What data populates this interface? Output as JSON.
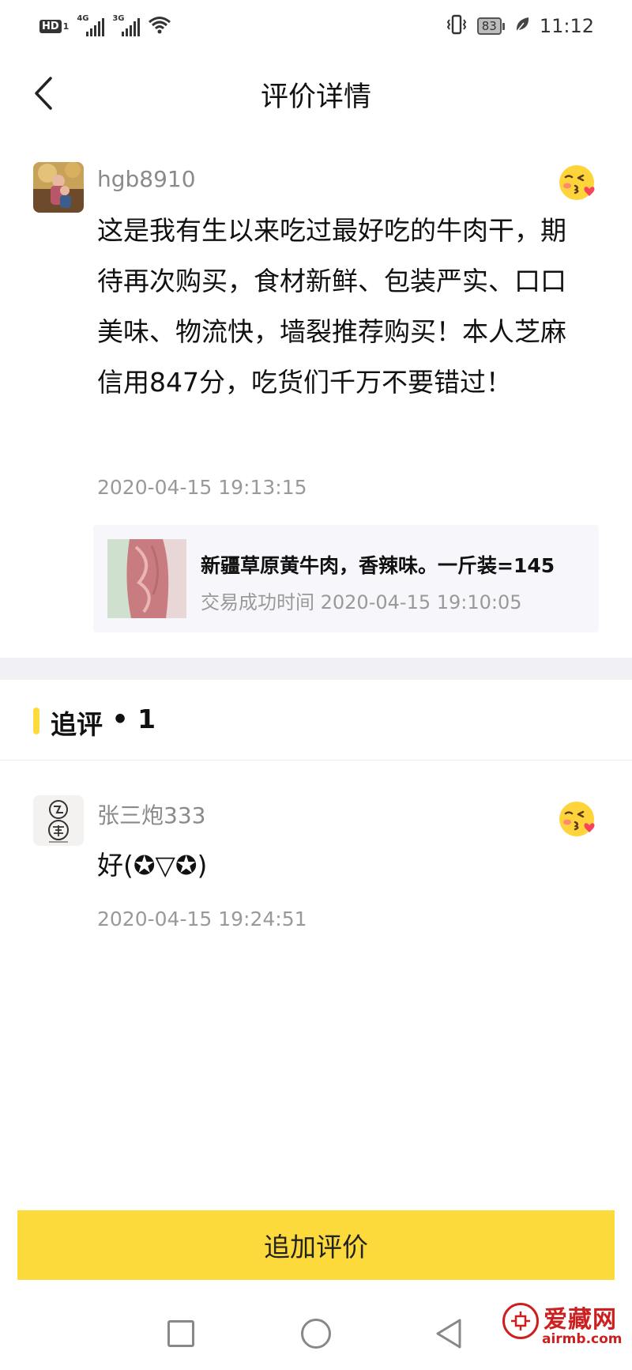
{
  "status_bar": {
    "hd_label": "HD",
    "hd_sub": "1",
    "sig1_gen": "4G",
    "sig2_gen": "3G",
    "battery": "83",
    "time": "11:12"
  },
  "header": {
    "title": "评价详情"
  },
  "review": {
    "username": "hgb8910",
    "content": "这是我有生以来吃过最好吃的牛肉干，期待再次购买，食材新鲜、包装严实、口口美味、物流快，墙裂推荐购买！本人芝麻信用847分，吃货们千万不要错过！",
    "time": "2020-04-15 19:13:15",
    "product": {
      "name": "新疆草原黄牛肉，香辣味。一斤装=145",
      "trade_time": "交易成功时间 2020-04-15 19:10:05"
    }
  },
  "followup_section": {
    "title": "追评",
    "separator": " • ",
    "count": "1"
  },
  "followup": {
    "username": "张三炮333",
    "content": "好(✪▽✪)",
    "time": "2020-04-15 19:24:51"
  },
  "bottom": {
    "add_review_label": "追加评价"
  },
  "watermark": {
    "text": "爱藏网",
    "url": "airmb.com"
  },
  "colors": {
    "accent": "#fdda3b",
    "muted_text": "#999999",
    "card_bg": "#f7f7fb",
    "watermark": "#cc1f1f"
  },
  "icons": [
    "back-arrow-icon",
    "kiss-emoji-icon",
    "vibrate-icon",
    "leaf-icon",
    "wifi-icon",
    "nav-square-icon",
    "nav-circle-icon",
    "nav-back-icon"
  ]
}
